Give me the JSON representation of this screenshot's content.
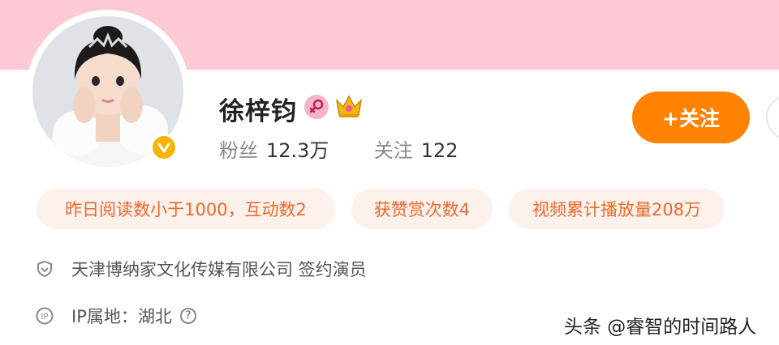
{
  "profile": {
    "name": "徐梓钧",
    "followers_label": "粉丝",
    "followers_value": "12.3万",
    "following_label": "关注",
    "following_value": "122"
  },
  "actions": {
    "follow_label": "+关注"
  },
  "tags": [
    "昨日阅读数小于1000，互动数2",
    "获赞赏次数4",
    "视频累计播放量208万"
  ],
  "info": {
    "company": "天津博纳家文化传媒有限公司 签约演员",
    "ip_location": "IP属地：湖北",
    "ip_icon_text": "IP"
  },
  "watermark": "头条 @睿智的时间路人",
  "colors": {
    "banner": "#fcc9d5",
    "accent": "#ff8200",
    "tag_bg": "#fdf1ec",
    "tag_text": "#e86a2c",
    "verified": "#f7b500"
  },
  "icons": [
    "verified-v-icon",
    "female-gender-icon",
    "crown-icon",
    "shield-icon",
    "ip-icon",
    "help-icon"
  ]
}
